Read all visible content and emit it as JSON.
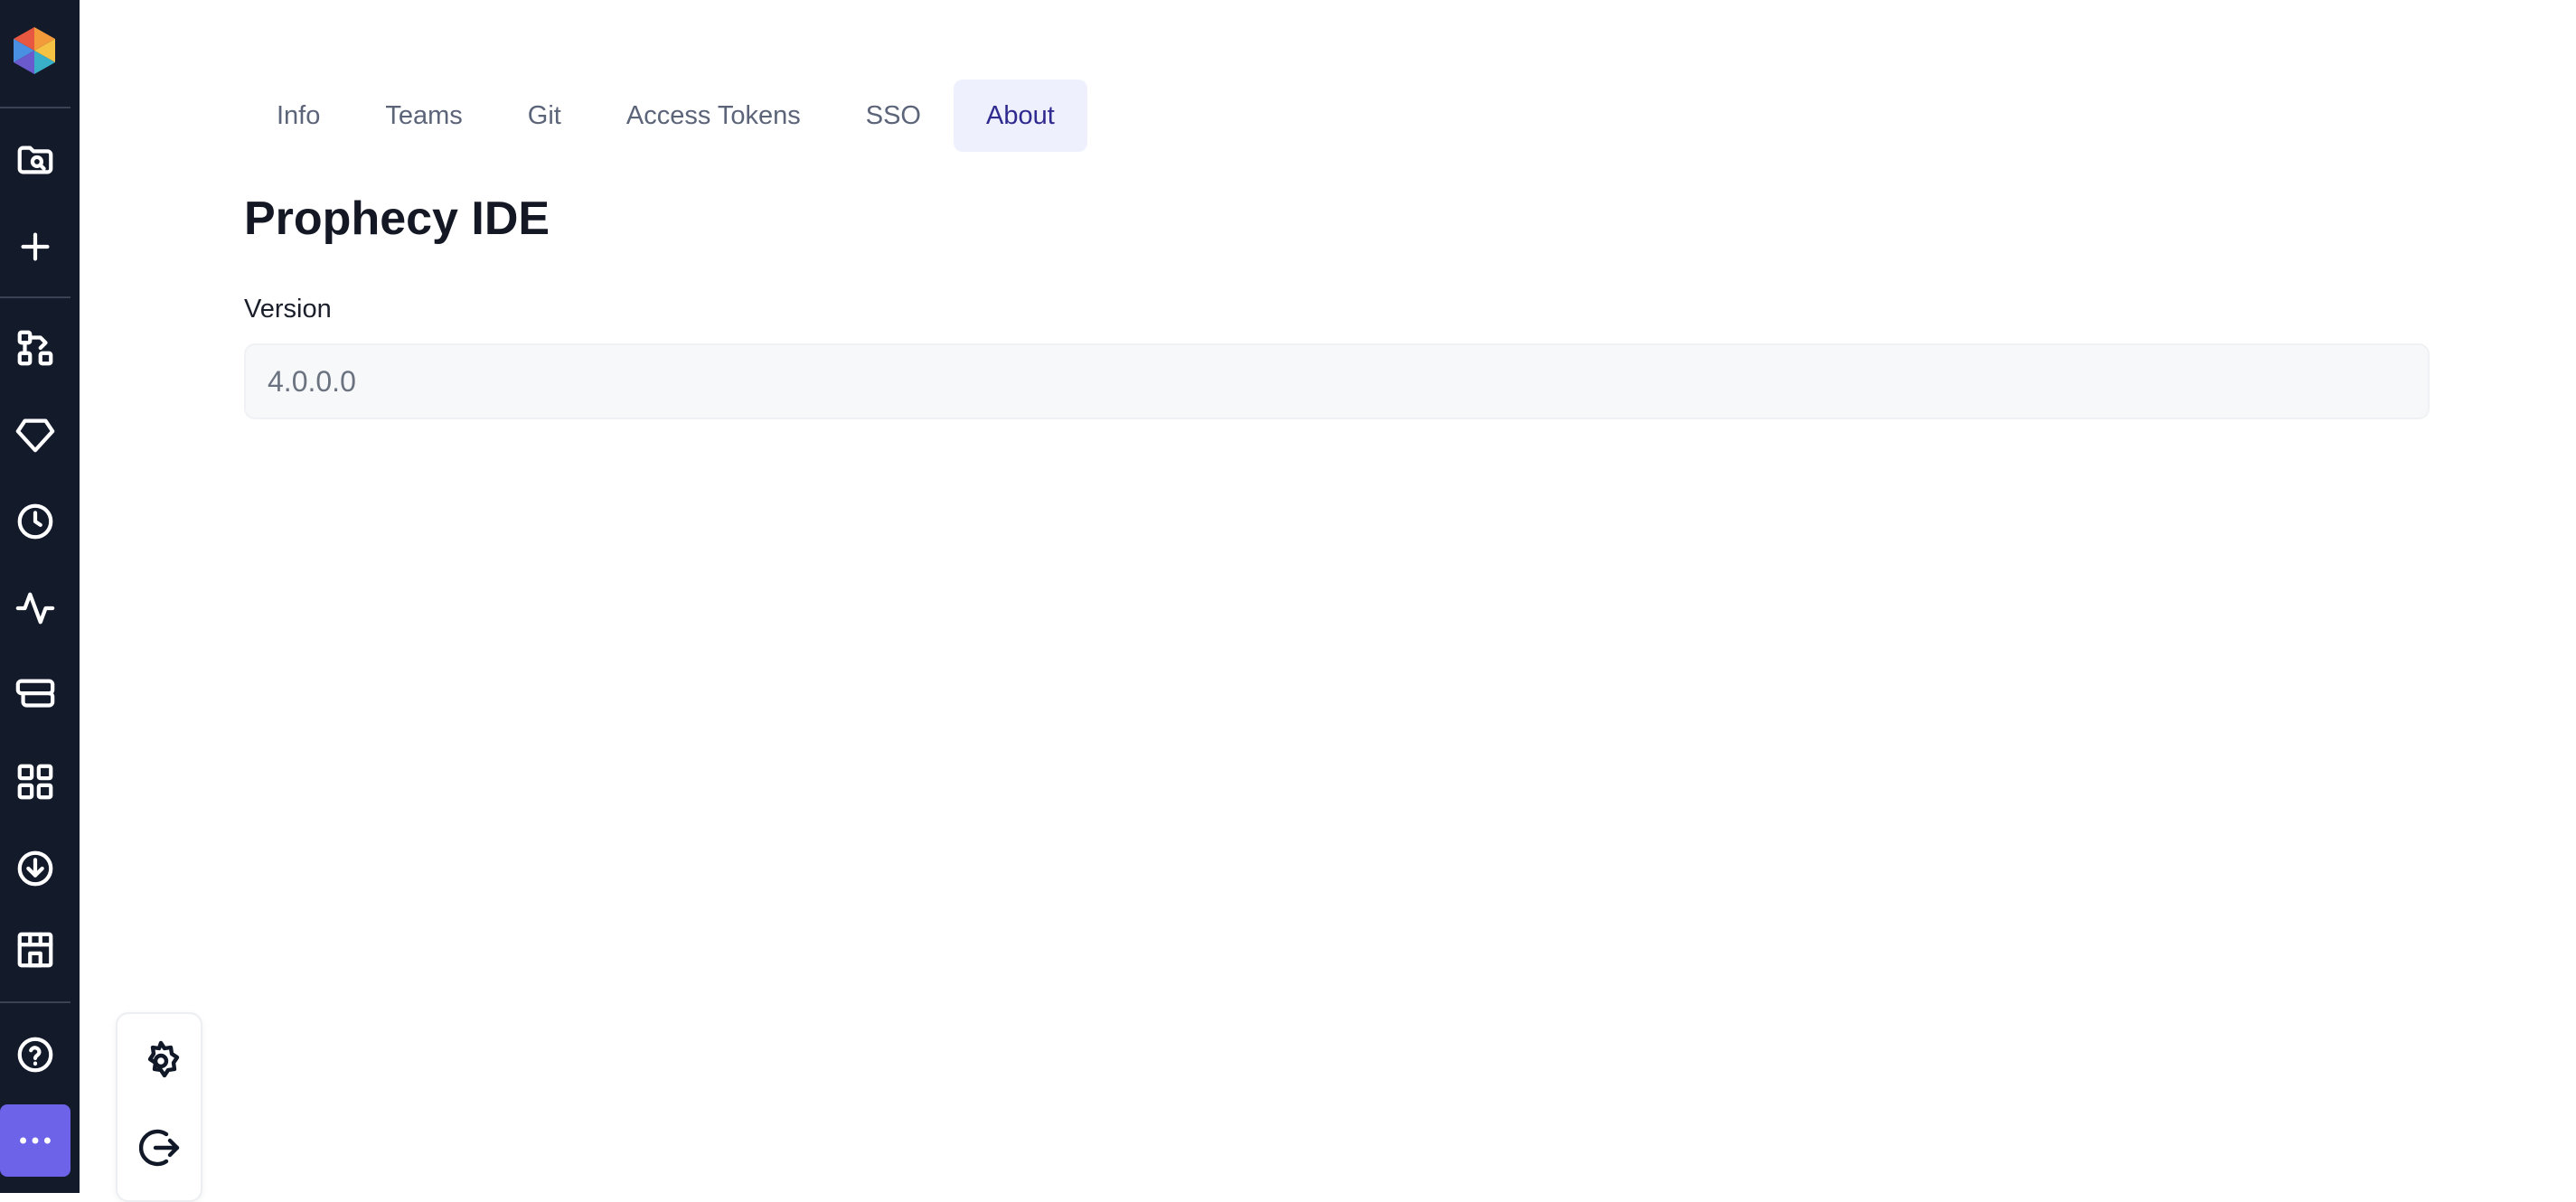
{
  "sidebar": {
    "logo": "prophecy-logo",
    "items": [
      {
        "icon": "folder-search-icon"
      },
      {
        "icon": "plus-icon"
      },
      {
        "icon": "workflow-icon"
      },
      {
        "icon": "gem-icon"
      },
      {
        "icon": "clock-icon"
      },
      {
        "icon": "activity-icon"
      },
      {
        "icon": "server-stack-icon"
      },
      {
        "icon": "grid-icon"
      },
      {
        "icon": "download-circle-icon"
      },
      {
        "icon": "store-icon"
      },
      {
        "icon": "help-circle-icon"
      }
    ],
    "more": {
      "icon": "more-dots-icon"
    }
  },
  "popout": {
    "items": [
      {
        "icon": "settings-gear-icon"
      },
      {
        "icon": "logout-icon"
      }
    ]
  },
  "tabs": [
    {
      "label": "Info",
      "active": false
    },
    {
      "label": "Teams",
      "active": false
    },
    {
      "label": "Git",
      "active": false
    },
    {
      "label": "Access Tokens",
      "active": false
    },
    {
      "label": "SSO",
      "active": false
    },
    {
      "label": "About",
      "active": true
    }
  ],
  "page": {
    "title": "Prophecy IDE",
    "version_label": "Version",
    "version_value": "4.0.0.0"
  },
  "colors": {
    "sidebar_bg": "#131a2a",
    "accent": "#6c63e8",
    "active_tab_bg": "#eef0fd",
    "active_tab_text": "#2f2a8f"
  }
}
